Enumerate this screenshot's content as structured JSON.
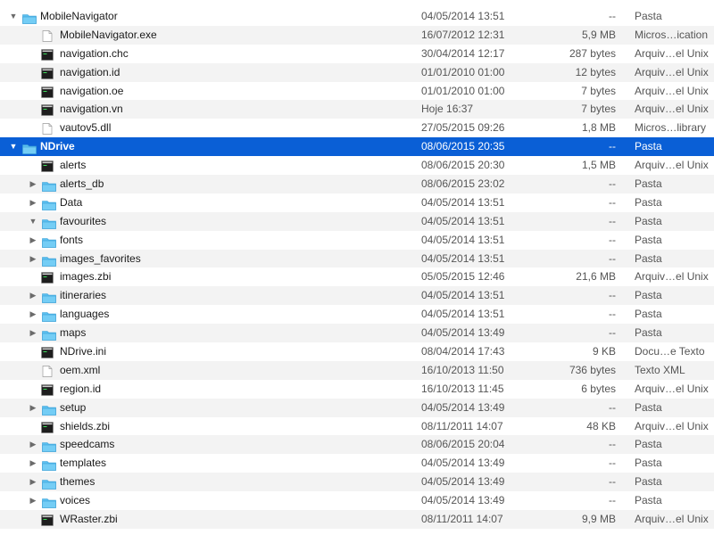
{
  "rows": [
    {
      "name": "MobileNavigator",
      "date": "04/05/2014 13:51",
      "size": "--",
      "kind": "Pasta",
      "icon": "folder-icon",
      "level": 0,
      "disclosure": "expanded"
    },
    {
      "name": "MobileNavigator.exe",
      "date": "16/07/2012 12:31",
      "size": "5,9 MB",
      "kind": "Micros…ication",
      "icon": "document-icon",
      "level": 1,
      "disclosure": "none"
    },
    {
      "name": "navigation.chc",
      "date": "30/04/2014 12:17",
      "size": "287 bytes",
      "kind": "Arquiv…el Unix",
      "icon": "exec-icon",
      "level": 1,
      "disclosure": "none"
    },
    {
      "name": "navigation.id",
      "date": "01/01/2010 01:00",
      "size": "12 bytes",
      "kind": "Arquiv…el Unix",
      "icon": "exec-icon",
      "level": 1,
      "disclosure": "none"
    },
    {
      "name": "navigation.oe",
      "date": "01/01/2010 01:00",
      "size": "7 bytes",
      "kind": "Arquiv…el Unix",
      "icon": "exec-icon",
      "level": 1,
      "disclosure": "none"
    },
    {
      "name": "navigation.vn",
      "date": "Hoje 16:37",
      "size": "7 bytes",
      "kind": "Arquiv…el Unix",
      "icon": "exec-icon",
      "level": 1,
      "disclosure": "none"
    },
    {
      "name": "vautov5.dll",
      "date": "27/05/2015 09:26",
      "size": "1,8 MB",
      "kind": "Micros…library",
      "icon": "document-icon",
      "level": 1,
      "disclosure": "none"
    },
    {
      "name": "NDrive",
      "date": "08/06/2015 20:35",
      "size": "--",
      "kind": "Pasta",
      "icon": "folder-icon",
      "level": 0,
      "disclosure": "expanded",
      "selected": true
    },
    {
      "name": "alerts",
      "date": "08/06/2015 20:30",
      "size": "1,5 MB",
      "kind": "Arquiv…el Unix",
      "icon": "exec-icon",
      "level": 1,
      "disclosure": "none"
    },
    {
      "name": "alerts_db",
      "date": "08/06/2015 23:02",
      "size": "--",
      "kind": "Pasta",
      "icon": "folder-icon",
      "level": 1,
      "disclosure": "collapsed"
    },
    {
      "name": "Data",
      "date": "04/05/2014 13:51",
      "size": "--",
      "kind": "Pasta",
      "icon": "folder-icon",
      "level": 1,
      "disclosure": "collapsed"
    },
    {
      "name": "favourites",
      "date": "04/05/2014 13:51",
      "size": "--",
      "kind": "Pasta",
      "icon": "folder-icon",
      "level": 1,
      "disclosure": "expanded"
    },
    {
      "name": "fonts",
      "date": "04/05/2014 13:51",
      "size": "--",
      "kind": "Pasta",
      "icon": "folder-icon",
      "level": 1,
      "disclosure": "collapsed"
    },
    {
      "name": "images_favorites",
      "date": "04/05/2014 13:51",
      "size": "--",
      "kind": "Pasta",
      "icon": "folder-icon",
      "level": 1,
      "disclosure": "collapsed"
    },
    {
      "name": "images.zbi",
      "date": "05/05/2015 12:46",
      "size": "21,6 MB",
      "kind": "Arquiv…el Unix",
      "icon": "exec-icon",
      "level": 1,
      "disclosure": "none"
    },
    {
      "name": "itineraries",
      "date": "04/05/2014 13:51",
      "size": "--",
      "kind": "Pasta",
      "icon": "folder-icon",
      "level": 1,
      "disclosure": "collapsed"
    },
    {
      "name": "languages",
      "date": "04/05/2014 13:51",
      "size": "--",
      "kind": "Pasta",
      "icon": "folder-icon",
      "level": 1,
      "disclosure": "collapsed"
    },
    {
      "name": "maps",
      "date": "04/05/2014 13:49",
      "size": "--",
      "kind": "Pasta",
      "icon": "folder-icon",
      "level": 1,
      "disclosure": "collapsed"
    },
    {
      "name": "NDrive.ini",
      "date": "08/04/2014 17:43",
      "size": "9 KB",
      "kind": "Docu…e Texto",
      "icon": "exec-icon",
      "level": 1,
      "disclosure": "none"
    },
    {
      "name": "oem.xml",
      "date": "16/10/2013 11:50",
      "size": "736 bytes",
      "kind": "Texto XML",
      "icon": "document-icon",
      "level": 1,
      "disclosure": "none"
    },
    {
      "name": "region.id",
      "date": "16/10/2013 11:45",
      "size": "6 bytes",
      "kind": "Arquiv…el Unix",
      "icon": "exec-icon",
      "level": 1,
      "disclosure": "none"
    },
    {
      "name": "setup",
      "date": "04/05/2014 13:49",
      "size": "--",
      "kind": "Pasta",
      "icon": "folder-icon",
      "level": 1,
      "disclosure": "collapsed"
    },
    {
      "name": "shields.zbi",
      "date": "08/11/2011 14:07",
      "size": "48 KB",
      "kind": "Arquiv…el Unix",
      "icon": "exec-icon",
      "level": 1,
      "disclosure": "none"
    },
    {
      "name": "speedcams",
      "date": "08/06/2015 20:04",
      "size": "--",
      "kind": "Pasta",
      "icon": "folder-icon",
      "level": 1,
      "disclosure": "collapsed"
    },
    {
      "name": "templates",
      "date": "04/05/2014 13:49",
      "size": "--",
      "kind": "Pasta",
      "icon": "folder-icon",
      "level": 1,
      "disclosure": "collapsed"
    },
    {
      "name": "themes",
      "date": "04/05/2014 13:49",
      "size": "--",
      "kind": "Pasta",
      "icon": "folder-icon",
      "level": 1,
      "disclosure": "collapsed"
    },
    {
      "name": "voices",
      "date": "04/05/2014 13:49",
      "size": "--",
      "kind": "Pasta",
      "icon": "folder-icon",
      "level": 1,
      "disclosure": "collapsed"
    },
    {
      "name": "WRaster.zbi",
      "date": "08/11/2011 14:07",
      "size": "9,9 MB",
      "kind": "Arquiv…el Unix",
      "icon": "exec-icon",
      "level": 1,
      "disclosure": "none"
    }
  ],
  "colors": {
    "selection": "#0a5fd6",
    "stripe": "#f3f3f3",
    "folder": "#5bc0f0"
  }
}
